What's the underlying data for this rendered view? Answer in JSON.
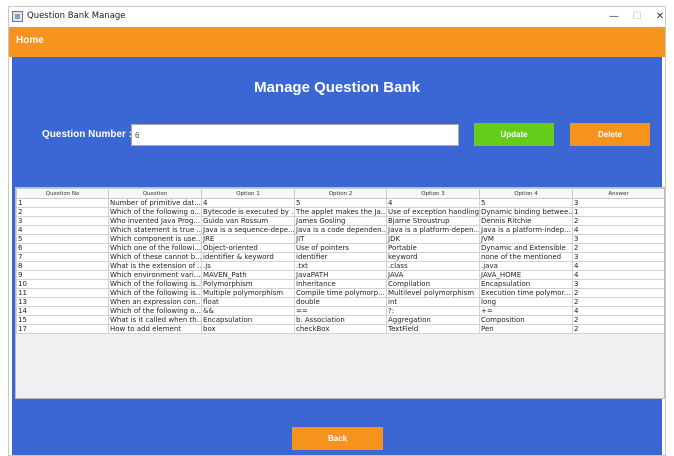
{
  "window": {
    "title": "Question Bank Manage",
    "controls": {
      "minimize": "—",
      "maximize": "☐",
      "close": "✕"
    },
    "icon": "app-icon"
  },
  "menu": {
    "home": "Home"
  },
  "page": {
    "title": "Manage Question Bank"
  },
  "form": {
    "question_number_label": "Question Number :",
    "question_number_value": "6",
    "update_label": "Update",
    "delete_label": "Delete"
  },
  "table": {
    "columns": [
      "Question No",
      "Question",
      "Option 1",
      "Option 2",
      "Option 3",
      "Option 4",
      "Answer"
    ],
    "rows": [
      [
        "1",
        "Number of primitive dat...",
        "4",
        "5",
        "4",
        "5",
        "3"
      ],
      [
        "2",
        "Which of the following o...",
        "Bytecode is executed by ...",
        "The applet makes the Ja...",
        "Use of exception handling",
        "Dynamic binding betwee...",
        "1"
      ],
      [
        "3",
        "Who invented Java Prog...",
        "Guido van Rossum",
        " James Gosling",
        "Bjarne Stroustrup",
        " Dennis Ritchie",
        "2"
      ],
      [
        "4",
        "Which statement is true ...",
        "Java is a sequence-depe...",
        "Java is a code dependen...",
        "Java is a platform-depen...",
        "Java is a platform-indep...",
        "4"
      ],
      [
        "5",
        "Which component is use...",
        "JRE",
        "JIT",
        "JDK",
        "JVM",
        "3"
      ],
      [
        "6",
        "Which one of the followi...",
        "Object-oriented",
        "Use of pointers",
        "Portable",
        "Dynamic and Extensible",
        "2"
      ],
      [
        "7",
        "Which of these cannot b...",
        "identifier & keyword",
        "identifier",
        "keyword",
        "none of the mentioned",
        "3"
      ],
      [
        "8",
        "What is the extension of ...",
        ".js",
        ".txt",
        ".class",
        ".java",
        "4"
      ],
      [
        "9",
        "Which environment vari...",
        "MAVEN_Path",
        "JavaPATH",
        "JAVA",
        "JAVA_HOME",
        "4"
      ],
      [
        "10",
        "Which of the following is...",
        "Polymorphism",
        "Inheritance",
        "Compilation",
        "Encapsulation",
        "3"
      ],
      [
        "11",
        "Which of the following is...",
        "Multiple polymorphism",
        "Compile time polymorp...",
        "Multilevel polymorphism",
        "Execution time polymor...",
        "2"
      ],
      [
        "13",
        "When an expression con...",
        "float",
        "double",
        "int",
        "long",
        "2"
      ],
      [
        "14",
        "Which of the following o...",
        "&&",
        "==",
        "?:",
        "+=",
        "4"
      ],
      [
        "15",
        "What is it called when th...",
        "Encapsulation",
        "b. Association",
        "Aggregation",
        "Composition",
        "2"
      ],
      [
        "17",
        "How to add element",
        "box",
        "checkBox",
        "TextField",
        "Pen",
        "2"
      ]
    ]
  },
  "footer": {
    "back_label": "Back"
  },
  "colors": {
    "panel": "#3a67d3",
    "orange": "#f6921e",
    "green": "#66cc1a"
  }
}
